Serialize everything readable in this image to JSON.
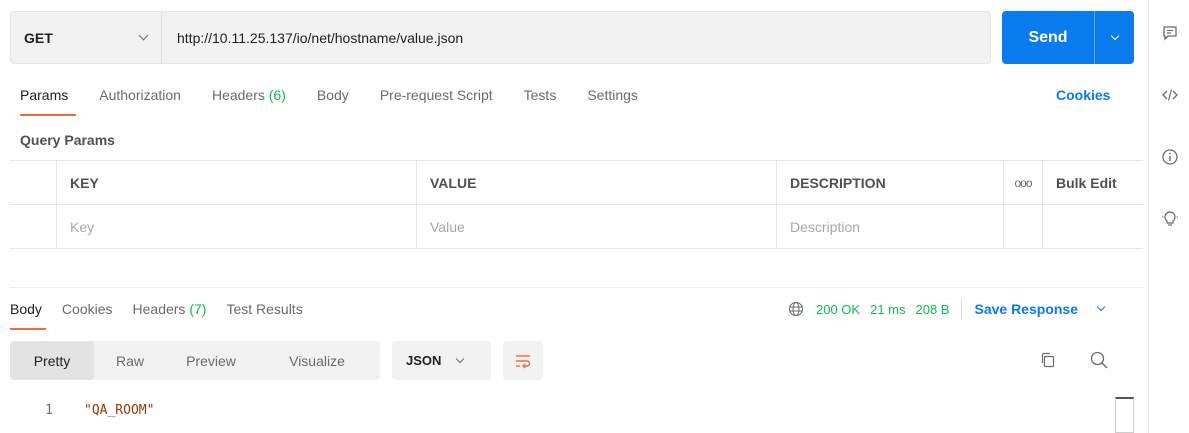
{
  "request": {
    "method": "GET",
    "url": "http://10.11.25.137/io/net/hostname/value.json",
    "send_label": "Send"
  },
  "request_tabs": [
    {
      "label": "Params",
      "count": ""
    },
    {
      "label": "Authorization",
      "count": ""
    },
    {
      "label": "Headers",
      "count": "(6)"
    },
    {
      "label": "Body",
      "count": ""
    },
    {
      "label": "Pre-request Script",
      "count": ""
    },
    {
      "label": "Tests",
      "count": ""
    },
    {
      "label": "Settings",
      "count": ""
    }
  ],
  "cookies_link": "Cookies",
  "query_params": {
    "title": "Query Params",
    "headers": {
      "key": "KEY",
      "value": "VALUE",
      "description": "DESCRIPTION",
      "more": "ooo",
      "bulk_edit": "Bulk Edit"
    },
    "placeholders": {
      "key": "Key",
      "value": "Value",
      "description": "Description"
    }
  },
  "response_tabs": [
    {
      "label": "Body",
      "count": ""
    },
    {
      "label": "Cookies",
      "count": ""
    },
    {
      "label": "Headers",
      "count": "(7)"
    },
    {
      "label": "Test Results",
      "count": ""
    }
  ],
  "response_status": {
    "status": "200 OK",
    "time": "21 ms",
    "size": "208 B",
    "save_label": "Save Response"
  },
  "view_modes": [
    "Pretty",
    "Raw",
    "Preview",
    "Visualize"
  ],
  "format": "JSON",
  "response_body": [
    {
      "line": "1",
      "text": "\"QA_ROOM\""
    }
  ],
  "icons": {
    "rail": [
      "comment-icon",
      "code-icon",
      "info-icon",
      "lightbulb-icon"
    ],
    "toolbar": [
      "wrap-icon",
      "copy-icon",
      "search-icon",
      "globe-icon"
    ]
  },
  "colors": {
    "accent": "#097bed",
    "tab_underline": "#f26b3a",
    "success": "#0cbb52"
  }
}
